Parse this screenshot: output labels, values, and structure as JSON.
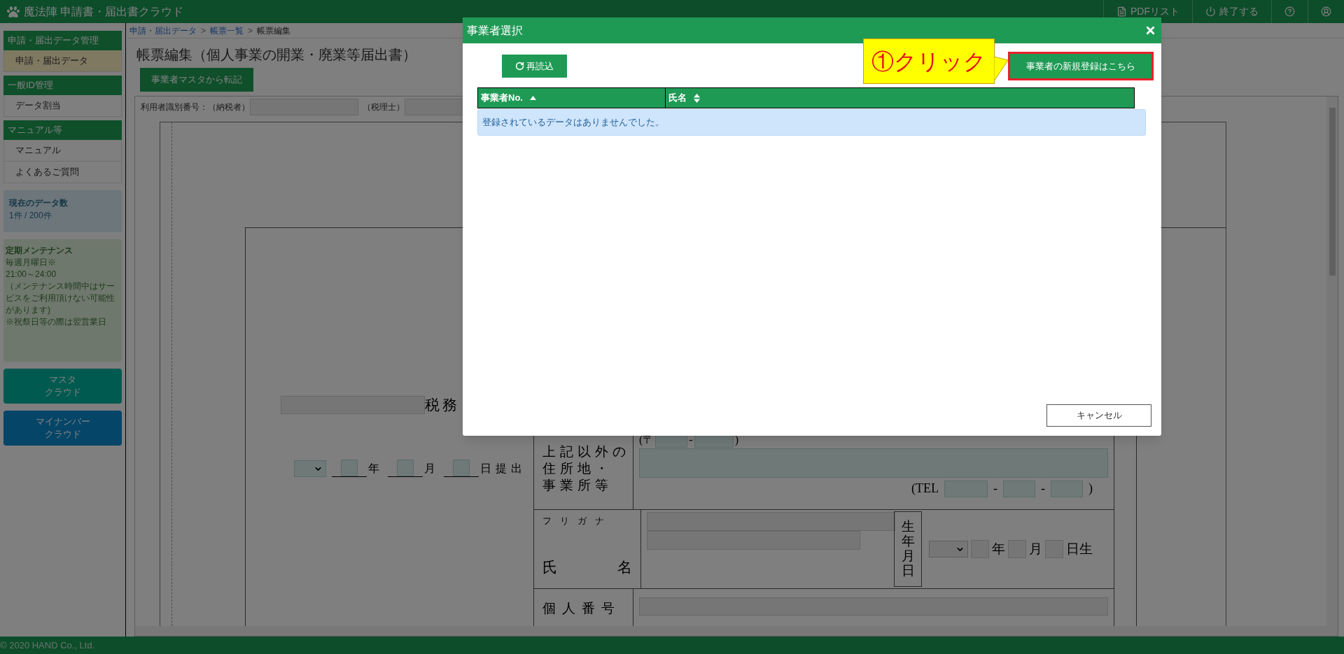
{
  "app": {
    "title": "魔法陣 申請書・届出書クラウド"
  },
  "header_links": [
    {
      "kind": "pdf",
      "label": "PDFリスト"
    },
    {
      "kind": "logout",
      "label": "終了する"
    },
    {
      "kind": "help"
    },
    {
      "kind": "user"
    }
  ],
  "sidebar": {
    "sections": [
      {
        "title": "申請・届出データ管理",
        "items": [
          {
            "label": "申請・届出データ",
            "selected": true
          }
        ]
      },
      {
        "title": "一般ID管理",
        "items": [
          {
            "label": "データ割当",
            "selected": false
          }
        ]
      },
      {
        "title": "マニュアル等",
        "items": [
          {
            "label": "マニュアル",
            "selected": false
          },
          {
            "label": "よくあるご質問",
            "selected": false
          }
        ]
      }
    ],
    "data_count": {
      "title": "現在のデータ数",
      "value": "1件 / 200件"
    },
    "maintenance": {
      "title": "定期メンテナンス",
      "lines": [
        "毎週月曜日※",
        "21:00～24:00",
        "（メンテナンス時間中はサービスをご利用頂けない可能性があります)",
        "※祝祭日等の際は翌営業日"
      ]
    },
    "links": [
      {
        "kind": "master",
        "lines": [
          "マスタ",
          "クラウド"
        ]
      },
      {
        "kind": "mynumber",
        "lines": [
          "マイナンバー",
          "クラウド"
        ]
      }
    ]
  },
  "breadcrumb": {
    "separator": ">",
    "items": [
      {
        "label": "申請・届出データ",
        "kind": "link"
      },
      {
        "label": "帳票一覧",
        "kind": "link"
      },
      {
        "label": "帳票編集",
        "kind": "current"
      }
    ]
  },
  "page_title": "帳票編集（個人事業の開業・廃業等届出書）",
  "transfer_button": "事業者マスタから転記",
  "form": {
    "taxpayer_label": "利用者識別番号：（納税者）",
    "accountant_label": "（税理士）",
    "office_suffix": "税務",
    "submission_date": {
      "year": "年",
      "month": "月",
      "day": "日提出"
    },
    "address": {
      "label_lines": [
        "上記以外の",
        "住所地・",
        "事業所等"
      ],
      "postal_open": "(〒",
      "postal_dash": "-",
      "postal_close": ")",
      "tel_open": "(TEL",
      "tel_dashes": [
        "-",
        "-"
      ],
      "tel_close": ")"
    },
    "name": {
      "furigana_label": "フリガナ",
      "name_label_first": "氏",
      "name_label_last": "名",
      "birth_label": "生年月日",
      "year": "年",
      "month": "月",
      "day": "日生"
    },
    "individual_number": {
      "label": "個人番号"
    }
  },
  "dialog": {
    "title": "事業者選択",
    "reload": "再読込",
    "new_button": "事業者の新規登録はこちら",
    "columns": [
      {
        "label": "事業者No.",
        "sorted": true
      },
      {
        "label": "氏名",
        "sorted": false
      }
    ],
    "empty_message": "登録されているデータはありませんでした。",
    "cancel": "キャンセル"
  },
  "annotation": {
    "text": "①クリック"
  },
  "footer": "© 2020 HAND Co., Ltd."
}
